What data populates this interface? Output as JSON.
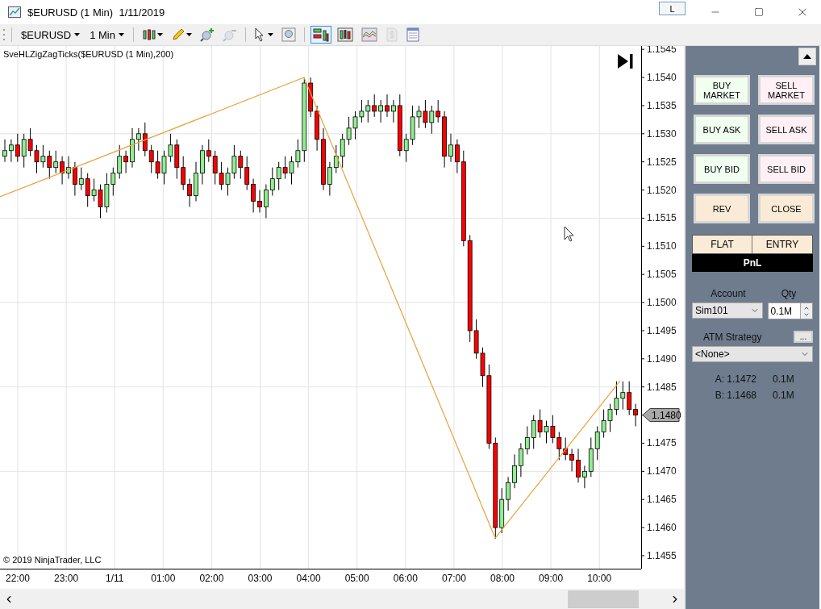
{
  "window": {
    "title": "$EURUSD (1 Min)  1/11/2019",
    "link_button": "L"
  },
  "toolbar": {
    "instrument": "$EURUSD",
    "interval": "1 Min",
    "tools": [
      {
        "kind": "candles",
        "caret": true,
        "selected": false,
        "disabled": false
      },
      {
        "kind": "pencil",
        "caret": true,
        "selected": false,
        "disabled": false
      },
      {
        "kind": "zoom-in",
        "caret": false,
        "selected": false,
        "disabled": false
      },
      {
        "kind": "zoom-out",
        "caret": false,
        "selected": false,
        "disabled": true
      },
      {
        "kind": "pointer",
        "caret": true,
        "selected": false,
        "disabled": false
      },
      {
        "kind": "zoom-box",
        "caret": false,
        "selected": false,
        "disabled": false
      },
      {
        "kind": "chart-trader",
        "caret": false,
        "selected": true,
        "disabled": false
      },
      {
        "kind": "bars",
        "caret": false,
        "selected": false,
        "disabled": false
      },
      {
        "kind": "line-chart",
        "caret": false,
        "selected": false,
        "disabled": false
      },
      {
        "kind": "dollar",
        "caret": false,
        "selected": false,
        "disabled": true
      },
      {
        "kind": "properties",
        "caret": false,
        "selected": false,
        "disabled": false
      }
    ]
  },
  "chart": {
    "indicator_label": "SveHLZigZagTicks($EURUSD (1 Min),200)",
    "copyright": "© 2019 NinjaTrader, LLC",
    "current_price": "1.1480",
    "time_labels": [
      "22:00",
      "23:00",
      "1/11",
      "01:00",
      "02:00",
      "03:00",
      "04:00",
      "05:00",
      "06:00",
      "07:00",
      "08:00",
      "09:00",
      "10:00"
    ],
    "chart_data": {
      "type": "candlestick",
      "ylim": [
        1.14527,
        1.15456
      ],
      "grid": true,
      "yticks": [
        {
          "value": 1.1545,
          "label": "1.1545"
        },
        {
          "value": 1.154,
          "label": "1.1540"
        },
        {
          "value": 1.1535,
          "label": "1.1535"
        },
        {
          "value": 1.153,
          "label": "1.1530"
        },
        {
          "value": 1.1525,
          "label": "1.1525"
        },
        {
          "value": 1.152,
          "label": "1.1520"
        },
        {
          "value": 1.1515,
          "label": "1.1515"
        },
        {
          "value": 1.151,
          "label": "1.1510"
        },
        {
          "value": 1.1505,
          "label": "1.1505"
        },
        {
          "value": 1.15,
          "label": "1.1500"
        },
        {
          "value": 1.1495,
          "label": "1.1495"
        },
        {
          "value": 1.149,
          "label": "1.1490"
        },
        {
          "value": 1.1485,
          "label": "1.1485"
        },
        {
          "value": 1.1475,
          "label": "1.1475"
        },
        {
          "value": 1.147,
          "label": "1.1470"
        },
        {
          "value": 1.1465,
          "label": "1.1465"
        },
        {
          "value": 1.146,
          "label": "1.1460"
        },
        {
          "value": 1.1455,
          "label": "1.1455"
        }
      ],
      "ohlc": [
        [
          1.1526,
          1.1529,
          1.1525,
          1.1527
        ],
        [
          1.1527,
          1.1529,
          1.1525,
          1.1528
        ],
        [
          1.1528,
          1.153,
          1.1525,
          1.1526
        ],
        [
          1.1526,
          1.153,
          1.1524,
          1.1529
        ],
        [
          1.1529,
          1.1531,
          1.1526,
          1.1527
        ],
        [
          1.1527,
          1.1528,
          1.1523,
          1.1525
        ],
        [
          1.1525,
          1.1528,
          1.1524,
          1.1526
        ],
        [
          1.1526,
          1.1527,
          1.1522,
          1.1524
        ],
        [
          1.1524,
          1.1527,
          1.1523,
          1.1525
        ],
        [
          1.1525,
          1.1526,
          1.1521,
          1.1523
        ],
        [
          1.1523,
          1.1526,
          1.1522,
          1.1524
        ],
        [
          1.1524,
          1.1525,
          1.1519,
          1.1521
        ],
        [
          1.1521,
          1.1524,
          1.152,
          1.1522
        ],
        [
          1.1522,
          1.1523,
          1.1517,
          1.1519
        ],
        [
          1.1519,
          1.1522,
          1.1518,
          1.152
        ],
        [
          1.152,
          1.1521,
          1.1515,
          1.1517
        ],
        [
          1.1517,
          1.1523,
          1.1516,
          1.1521
        ],
        [
          1.1521,
          1.1524,
          1.1519,
          1.1523
        ],
        [
          1.1523,
          1.1528,
          1.1522,
          1.1526
        ],
        [
          1.1526,
          1.1527,
          1.1523,
          1.1525
        ],
        [
          1.1525,
          1.1531,
          1.1524,
          1.1529
        ],
        [
          1.1529,
          1.1531,
          1.1527,
          1.153
        ],
        [
          1.153,
          1.1532,
          1.1526,
          1.1527
        ],
        [
          1.1527,
          1.1528,
          1.1523,
          1.1525
        ],
        [
          1.1525,
          1.1527,
          1.1522,
          1.1523
        ],
        [
          1.1523,
          1.1527,
          1.1521,
          1.1526
        ],
        [
          1.1526,
          1.153,
          1.1525,
          1.1528
        ],
        [
          1.1528,
          1.1529,
          1.1522,
          1.1524
        ],
        [
          1.1524,
          1.1526,
          1.152,
          1.1521
        ],
        [
          1.1521,
          1.1522,
          1.1517,
          1.1519
        ],
        [
          1.1519,
          1.1525,
          1.1518,
          1.1523
        ],
        [
          1.1523,
          1.1528,
          1.1521,
          1.1527
        ],
        [
          1.1527,
          1.1529,
          1.1525,
          1.1526
        ],
        [
          1.1526,
          1.1527,
          1.1521,
          1.1523
        ],
        [
          1.1523,
          1.1525,
          1.152,
          1.1521
        ],
        [
          1.1521,
          1.1524,
          1.1519,
          1.1523
        ],
        [
          1.1523,
          1.1528,
          1.1522,
          1.1526
        ],
        [
          1.1526,
          1.1527,
          1.1522,
          1.1524
        ],
        [
          1.1524,
          1.1526,
          1.152,
          1.1521
        ],
        [
          1.1521,
          1.1522,
          1.1516,
          1.1518
        ],
        [
          1.1518,
          1.152,
          1.1516,
          1.1517
        ],
        [
          1.1517,
          1.1521,
          1.1515,
          1.152
        ],
        [
          1.152,
          1.1524,
          1.1519,
          1.1522
        ],
        [
          1.1522,
          1.1525,
          1.152,
          1.1524
        ],
        [
          1.1524,
          1.1526,
          1.1522,
          1.1523
        ],
        [
          1.1523,
          1.1526,
          1.1521,
          1.1525
        ],
        [
          1.1525,
          1.1529,
          1.1524,
          1.1527
        ],
        [
          1.1527,
          1.154,
          1.1525,
          1.1539
        ],
        [
          1.1539,
          1.154,
          1.1533,
          1.1534
        ],
        [
          1.1534,
          1.1535,
          1.1527,
          1.1529
        ],
        [
          1.1529,
          1.1531,
          1.152,
          1.1521
        ],
        [
          1.1521,
          1.1525,
          1.1519,
          1.1524
        ],
        [
          1.1524,
          1.1528,
          1.1523,
          1.1526
        ],
        [
          1.1526,
          1.153,
          1.1524,
          1.1529
        ],
        [
          1.1529,
          1.1533,
          1.1528,
          1.1531
        ],
        [
          1.1531,
          1.1534,
          1.1529,
          1.1533
        ],
        [
          1.1533,
          1.1536,
          1.1532,
          1.1534
        ],
        [
          1.1534,
          1.1536,
          1.1532,
          1.1535
        ],
        [
          1.1535,
          1.1537,
          1.1533,
          1.1534
        ],
        [
          1.1534,
          1.1536,
          1.1532,
          1.1535
        ],
        [
          1.1535,
          1.1537,
          1.1533,
          1.1534
        ],
        [
          1.1534,
          1.1536,
          1.1532,
          1.1535
        ],
        [
          1.1535,
          1.1537,
          1.1526,
          1.1527
        ],
        [
          1.1527,
          1.153,
          1.1525,
          1.1529
        ],
        [
          1.1529,
          1.1535,
          1.1528,
          1.1533
        ],
        [
          1.1533,
          1.1535,
          1.1531,
          1.1534
        ],
        [
          1.1534,
          1.1536,
          1.1531,
          1.1532
        ],
        [
          1.1532,
          1.1535,
          1.153,
          1.1534
        ],
        [
          1.1534,
          1.1536,
          1.1532,
          1.1533
        ],
        [
          1.1533,
          1.1534,
          1.1524,
          1.1526
        ],
        [
          1.1526,
          1.153,
          1.1525,
          1.1528
        ],
        [
          1.1528,
          1.1529,
          1.1523,
          1.1525
        ],
        [
          1.1525,
          1.1527,
          1.151,
          1.1511
        ],
        [
          1.1511,
          1.1512,
          1.1493,
          1.1495
        ],
        [
          1.1495,
          1.1497,
          1.149,
          1.1491
        ],
        [
          1.1491,
          1.1492,
          1.1485,
          1.1487
        ],
        [
          1.1487,
          1.1489,
          1.1474,
          1.1475
        ],
        [
          1.1475,
          1.1476,
          1.1458,
          1.146
        ],
        [
          1.146,
          1.1467,
          1.1459,
          1.1465
        ],
        [
          1.1465,
          1.1469,
          1.1463,
          1.1468
        ],
        [
          1.1468,
          1.1473,
          1.1467,
          1.1471
        ],
        [
          1.1471,
          1.1475,
          1.1469,
          1.1474
        ],
        [
          1.1474,
          1.1478,
          1.1473,
          1.1476
        ],
        [
          1.1476,
          1.148,
          1.1474,
          1.1479
        ],
        [
          1.1479,
          1.1481,
          1.1476,
          1.1477
        ],
        [
          1.1477,
          1.1479,
          1.1475,
          1.1478
        ],
        [
          1.1478,
          1.148,
          1.1475,
          1.1476
        ],
        [
          1.1476,
          1.1477,
          1.1472,
          1.1474
        ],
        [
          1.1474,
          1.1476,
          1.1472,
          1.1473
        ],
        [
          1.1473,
          1.1474,
          1.147,
          1.1472
        ],
        [
          1.1472,
          1.1474,
          1.1468,
          1.1469
        ],
        [
          1.1469,
          1.1471,
          1.1467,
          1.147
        ],
        [
          1.147,
          1.1476,
          1.1469,
          1.1474
        ],
        [
          1.1474,
          1.1478,
          1.1472,
          1.1477
        ],
        [
          1.1477,
          1.1481,
          1.1476,
          1.1479
        ],
        [
          1.1479,
          1.1482,
          1.1477,
          1.1481
        ],
        [
          1.1481,
          1.1486,
          1.148,
          1.1483
        ],
        [
          1.1483,
          1.1486,
          1.1481,
          1.1484
        ],
        [
          1.1484,
          1.1486,
          1.148,
          1.1481
        ],
        [
          1.1481,
          1.1482,
          1.1478,
          1.148
        ]
      ]
    }
  },
  "trader_panel": {
    "buttons": [
      {
        "label": "BUY MARKET",
        "kind": "buy"
      },
      {
        "label": "SELL MARKET",
        "kind": "sell"
      },
      {
        "label": "BUY ASK",
        "kind": "buy"
      },
      {
        "label": "SELL ASK",
        "kind": "sell"
      },
      {
        "label": "BUY BID",
        "kind": "buy"
      },
      {
        "label": "SELL BID",
        "kind": "sell"
      },
      {
        "label": "REV",
        "kind": "neutral"
      },
      {
        "label": "CLOSE",
        "kind": "neutral"
      }
    ],
    "flat": "FLAT",
    "entry": "ENTRY",
    "pnl": "PnL",
    "account_label": "Account",
    "account": "Sim101",
    "qty_label": "Qty",
    "qty": "0.1M",
    "atm_label": "ATM Strategy",
    "atm_button": "...",
    "atm_strategy": "<None>",
    "quotes": [
      {
        "price": "A: 1.1472",
        "size": "0.1M"
      },
      {
        "price": "B: 1.1468",
        "size": "0.1M"
      }
    ]
  }
}
